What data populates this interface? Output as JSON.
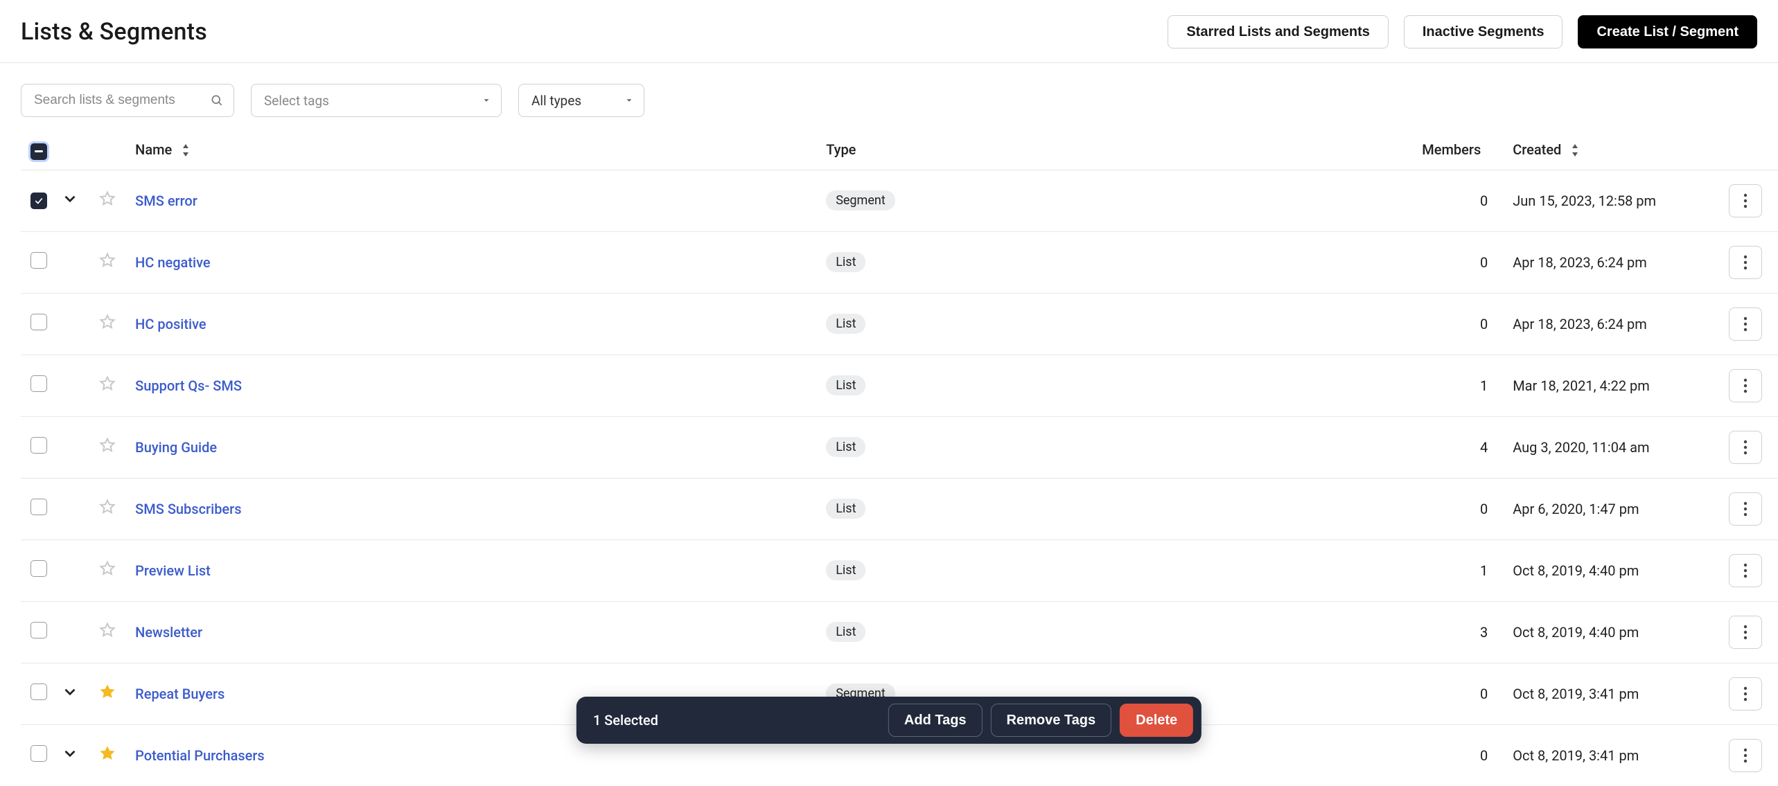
{
  "header": {
    "title": "Lists & Segments",
    "actions": {
      "starred": "Starred Lists and Segments",
      "inactive": "Inactive Segments",
      "create": "Create List / Segment"
    }
  },
  "filters": {
    "search_placeholder": "Search lists & segments",
    "tags_placeholder": "Select tags",
    "types_label": "All types"
  },
  "table": {
    "columns": {
      "name": "Name",
      "type": "Type",
      "members": "Members",
      "created": "Created"
    },
    "rows": [
      {
        "checked": true,
        "expandable": true,
        "starred": false,
        "name": "SMS error",
        "type": "Segment",
        "members": "0",
        "created": "Jun 15, 2023, 12:58 pm"
      },
      {
        "checked": false,
        "expandable": false,
        "starred": false,
        "name": "HC negative",
        "type": "List",
        "members": "0",
        "created": "Apr 18, 2023, 6:24 pm"
      },
      {
        "checked": false,
        "expandable": false,
        "starred": false,
        "name": "HC positive",
        "type": "List",
        "members": "0",
        "created": "Apr 18, 2023, 6:24 pm"
      },
      {
        "checked": false,
        "expandable": false,
        "starred": false,
        "name": "Support Qs- SMS",
        "type": "List",
        "members": "1",
        "created": "Mar 18, 2021, 4:22 pm"
      },
      {
        "checked": false,
        "expandable": false,
        "starred": false,
        "name": "Buying Guide",
        "type": "List",
        "members": "4",
        "created": "Aug 3, 2020, 11:04 am"
      },
      {
        "checked": false,
        "expandable": false,
        "starred": false,
        "name": "SMS Subscribers",
        "type": "List",
        "members": "0",
        "created": "Apr 6, 2020, 1:47 pm"
      },
      {
        "checked": false,
        "expandable": false,
        "starred": false,
        "name": "Preview List",
        "type": "List",
        "members": "1",
        "created": "Oct 8, 2019, 4:40 pm"
      },
      {
        "checked": false,
        "expandable": false,
        "starred": false,
        "name": "Newsletter",
        "type": "List",
        "members": "3",
        "created": "Oct 8, 2019, 4:40 pm"
      },
      {
        "checked": false,
        "expandable": true,
        "starred": true,
        "name": "Repeat Buyers",
        "type": "Segment",
        "members": "0",
        "created": "Oct 8, 2019, 3:41 pm"
      },
      {
        "checked": false,
        "expandable": true,
        "starred": true,
        "name": "Potential Purchasers",
        "type": "",
        "members": "0",
        "created": "Oct 8, 2019, 3:41 pm"
      }
    ]
  },
  "selection_toast": {
    "count_label": "1 Selected",
    "add_tags": "Add Tags",
    "remove_tags": "Remove Tags",
    "delete": "Delete"
  }
}
